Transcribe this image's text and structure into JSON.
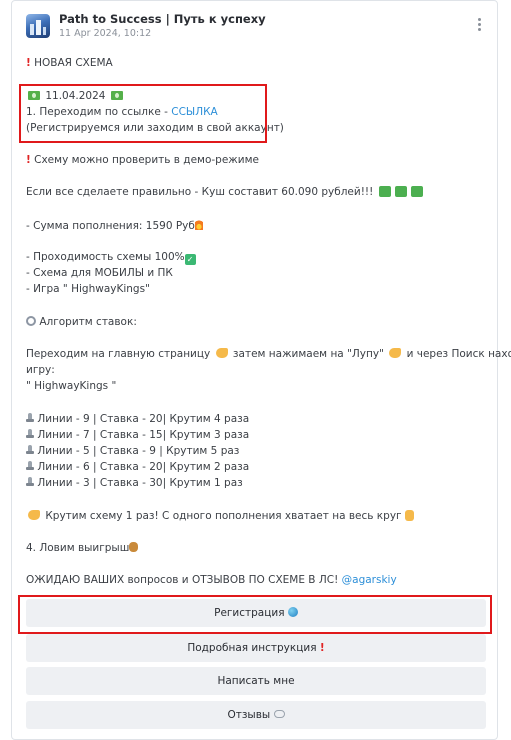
{
  "post": {
    "channel": "Path to Success | Путь к успеху",
    "date": "11 Apr 2024, 10:12"
  },
  "body": {
    "l01": "НОВАЯ СХЕМА",
    "l02": "11.04.2024",
    "l03a": "1. Переходим по ссылке - ",
    "l03b": "ССЫЛКА",
    "l04": "(Регистрируемся или заходим в свой аккаунт)",
    "l05": "Схему можно проверить в демо-режиме",
    "l06": "Если все сделаете правильно - Куш составит 60.090 рублей!!!",
    "l07": "- Сумма пополнения: 1590 Руб",
    "l08": "- Проходимость схемы 100%",
    "l09": "- Схема для МОБИЛЫ и ПК",
    "l10": "- Игра \" HighwayKings\"",
    "l11": "Алгоритм ставок:",
    "l12a": "Переходим на главную страницу ",
    "l12b": " затем нажимаем на \"Лупу\" ",
    "l12c": " и через Поиск находим",
    "l13": "игру:",
    "l14": "\" HighwayKings \"",
    "l15": "Линии - 9 | Ставка - 20| Крутим 4 раза",
    "l16": "Линии - 7 | Ставка - 15| Крутим 3 раза",
    "l17": "Линии - 5 | Ставка - 9 | Крутим 5 раз",
    "l18": "Линии - 6 | Ставка - 20| Крутим 2 раза",
    "l19": "Линии - 3 | Ставка - 30| Крутим 1 раз",
    "l20": "Крутим схему 1 раз! С одного пополнения хватает на весь круг",
    "l21": "4. Ловим выигрыш",
    "l22a": "ОЖИДАЮ ВАШИХ вопросов и ОТЗЫВОВ ПО СХЕМЕ В ЛС! ",
    "l22b": "@agarskiy"
  },
  "buttons": {
    "register": "Регистрация",
    "instructions": "Подробная инструкция",
    "write_me": "Написать мне",
    "reviews": "Отзывы"
  },
  "colors": {
    "link": "#2d8fd8",
    "highlight": "#e0191b",
    "button_bg": "#eef0f3"
  }
}
